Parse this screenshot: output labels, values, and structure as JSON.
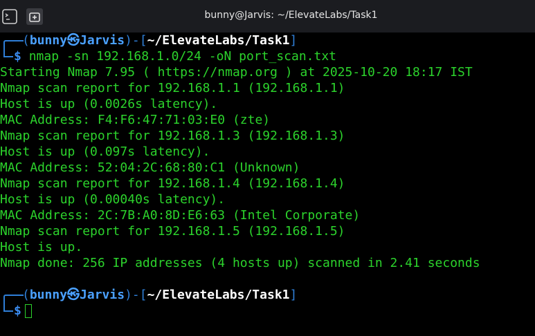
{
  "window": {
    "title": "bunny@Jarvis: ~/ElevateLabs/Task1",
    "terminal_button_icon": "terminal-icon",
    "new_tab_button_icon": "new-tab-icon"
  },
  "prompt": {
    "open_paren": "(",
    "user": "bunny",
    "separator_glyph": "㉿",
    "host": "Jarvis",
    "close_paren": ")",
    "dash": "-",
    "open_bracket": "[",
    "path": "~/ElevateLabs/Task1",
    "close_bracket": "]",
    "dollar": "$"
  },
  "command": {
    "program": "nmap",
    "args": " -sn 192.168.1.0/24 -oN port_scan.txt"
  },
  "output": [
    "Starting Nmap 7.95 ( https://nmap.org ) at 2025-10-20 18:17 IST",
    "Nmap scan report for 192.168.1.1 (192.168.1.1)",
    "Host is up (0.0026s latency).",
    "MAC Address: F4:F6:47:71:03:E0 (zte)",
    "Nmap scan report for 192.168.1.3 (192.168.1.3)",
    "Host is up (0.097s latency).",
    "MAC Address: 52:04:2C:68:80:C1 (Unknown)",
    "Nmap scan report for 192.168.1.4 (192.168.1.4)",
    "Host is up (0.00040s latency).",
    "MAC Address: 2C:7B:A0:8D:E6:63 (Intel Corporate)",
    "Nmap scan report for 192.168.1.5 (192.168.1.5)",
    "Host is up.",
    "Nmap done: 256 IP addresses (4 hosts up) scanned in 2.41 seconds"
  ],
  "colors": {
    "background": "#000000",
    "titlebar": "#1b1c20",
    "output_green": "#2cd32c",
    "prompt_blue": "#2f7fd8"
  }
}
